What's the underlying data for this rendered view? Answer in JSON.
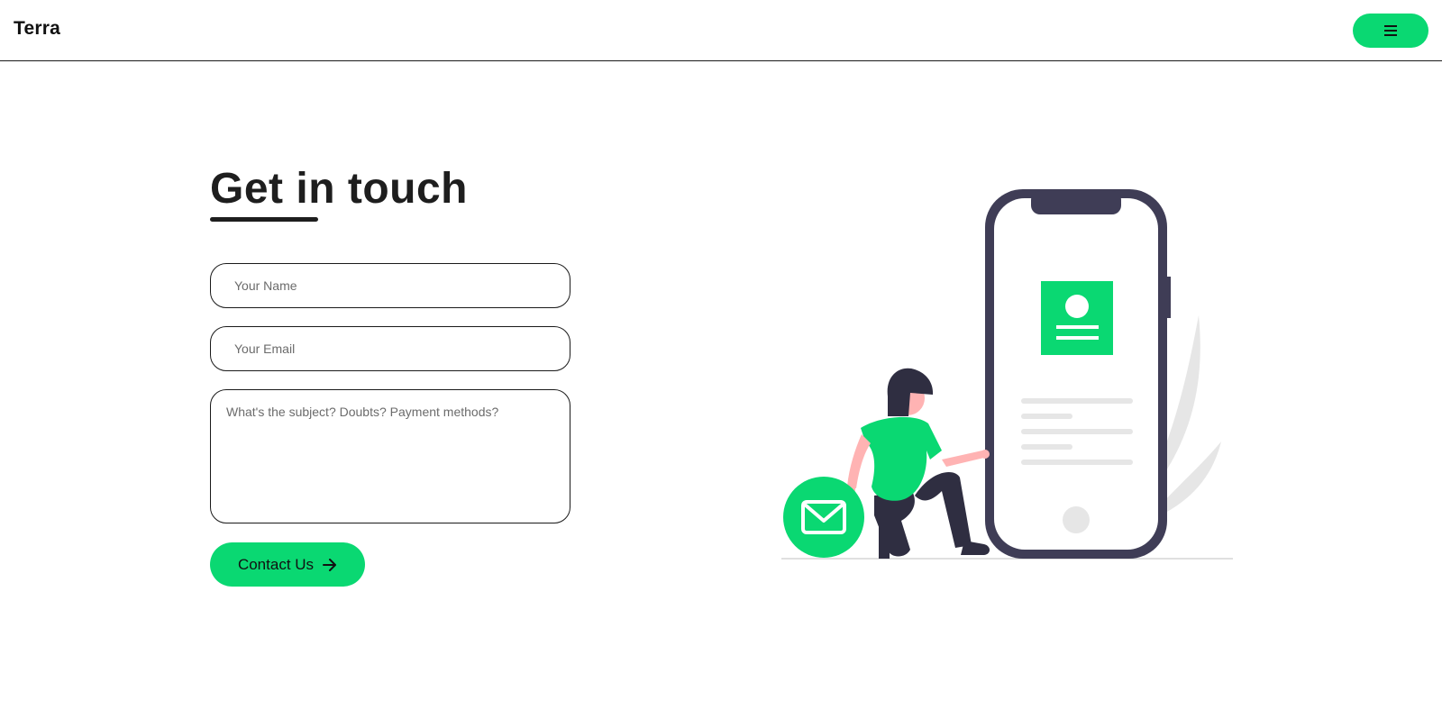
{
  "header": {
    "logo": "Terra",
    "menu_icon": "hamburger-menu-icon"
  },
  "main": {
    "title": "Get in touch",
    "form": {
      "name_placeholder": "Your Name",
      "email_placeholder": "Your Email",
      "subject_placeholder": "What's the subject? Doubts? Payment methods?",
      "submit_label": "Contact Us",
      "submit_icon": "arrow-right-icon"
    }
  },
  "colors": {
    "accent": "#0ad872",
    "text": "#1e1e1e",
    "phone_frame": "#3f3d56",
    "skin": "#ffb3b3"
  }
}
